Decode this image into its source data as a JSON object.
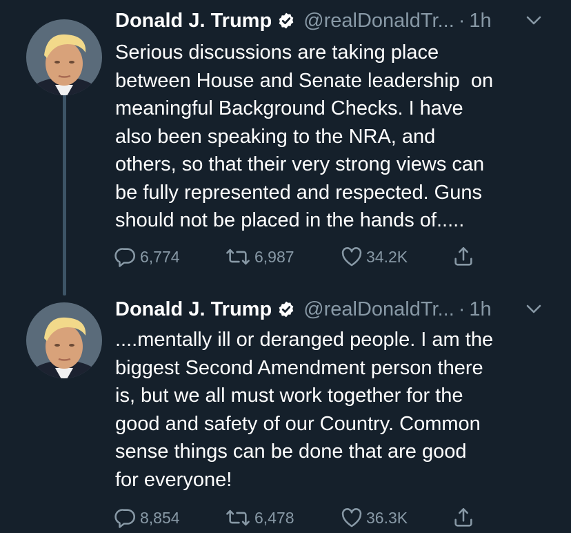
{
  "thread": [
    {
      "author": {
        "name": "Donald J. Trump",
        "handle": "@realDonaldTr...",
        "verified": true
      },
      "separator": "·",
      "time": "1h",
      "text": "Serious discussions are taking place\nbetween House and Senate leadership  on\nmeaningful Background Checks. I have\nalso been speaking to the NRA, and\nothers, so that their very strong views can\nbe fully represented and respected. Guns\nshould not be placed in the hands of.....",
      "stats": {
        "replies": "6,774",
        "retweets": "6,987",
        "likes": "34.2K"
      }
    },
    {
      "author": {
        "name": "Donald J. Trump",
        "handle": "@realDonaldTr...",
        "verified": true
      },
      "separator": "·",
      "time": "1h",
      "text": "....mentally ill or deranged people. I am the\nbiggest Second Amendment person there\nis, but we all must work together for the\ngood and safety of our Country. Common\nsense things can be done that are good\nfor everyone!",
      "stats": {
        "replies": "8,854",
        "retweets": "6,478",
        "likes": "36.3K"
      }
    }
  ],
  "icons": {
    "reply": "speech-bubble-icon",
    "retweet": "retweet-arrows-icon",
    "like": "heart-icon",
    "share": "share-upload-icon",
    "verified": "verified-badge-icon",
    "more": "chevron-down-icon"
  },
  "colors": {
    "background": "#15202b",
    "text": "#ffffff",
    "secondary": "#8899a6",
    "verified_badge": "#ffffff",
    "thread_line": "#3d5466"
  }
}
